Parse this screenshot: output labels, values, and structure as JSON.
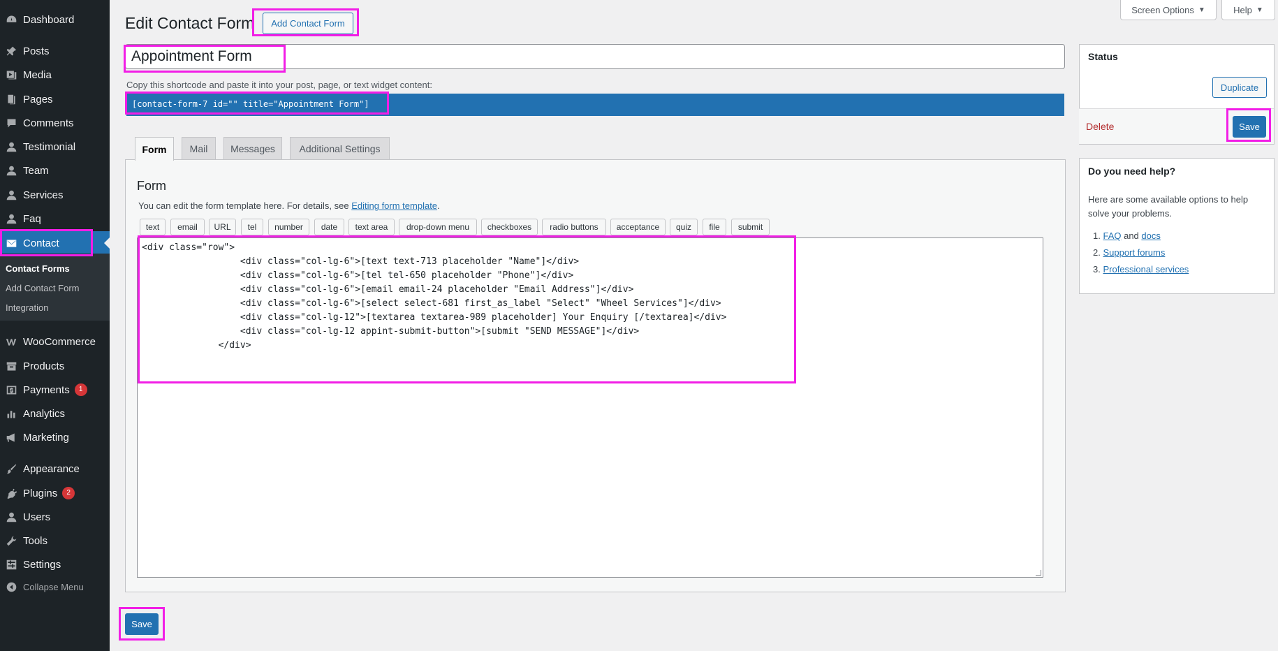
{
  "sidebar": {
    "items": [
      {
        "label": "Dashboard",
        "icon": "dashboard-icon"
      },
      {
        "label": "Posts",
        "icon": "pushpin-icon"
      },
      {
        "label": "Media",
        "icon": "media-icon"
      },
      {
        "label": "Pages",
        "icon": "pages-icon"
      },
      {
        "label": "Comments",
        "icon": "comments-icon"
      },
      {
        "label": "Testimonial",
        "icon": "user-icon"
      },
      {
        "label": "Team",
        "icon": "user-icon"
      },
      {
        "label": "Services",
        "icon": "user-icon"
      },
      {
        "label": "Faq",
        "icon": "user-icon"
      },
      {
        "label": "Contact",
        "icon": "envelope-icon"
      },
      {
        "label": "WooCommerce",
        "icon": "woocommerce-icon"
      },
      {
        "label": "Products",
        "icon": "archive-icon"
      },
      {
        "label": "Payments",
        "icon": "dollar-icon",
        "badge": "1"
      },
      {
        "label": "Analytics",
        "icon": "bar-chart-icon"
      },
      {
        "label": "Marketing",
        "icon": "megaphone-icon"
      },
      {
        "label": "Appearance",
        "icon": "paintbrush-icon"
      },
      {
        "label": "Plugins",
        "icon": "plugin-icon",
        "badge": "2"
      },
      {
        "label": "Users",
        "icon": "users-icon"
      },
      {
        "label": "Tools",
        "icon": "wrench-icon"
      },
      {
        "label": "Settings",
        "icon": "settings-icon"
      }
    ],
    "submenu": [
      "Contact Forms",
      "Add Contact Form",
      "Integration"
    ],
    "collapse_label": "Collapse Menu"
  },
  "header": {
    "title": "Edit Contact Form",
    "add_button": "Add Contact Form",
    "screen_options": "Screen Options",
    "help": "Help"
  },
  "form_title": "Appointment Form",
  "shortcode": {
    "description": "Copy this shortcode and paste it into your post, page, or text widget content:",
    "value": "[contact-form-7 id=\"\" title=\"Appointment Form\"]"
  },
  "tabs": [
    "Form",
    "Mail",
    "Messages",
    "Additional Settings"
  ],
  "panel": {
    "title": "Form",
    "desc_prefix": "You can edit the form template here. For details, see ",
    "desc_link": "Editing form template",
    "desc_suffix": "."
  },
  "tag_buttons": [
    "text",
    "email",
    "URL",
    "tel",
    "number",
    "date",
    "text area",
    "drop-down menu",
    "checkboxes",
    "radio buttons",
    "acceptance",
    "quiz",
    "file",
    "submit"
  ],
  "code_lines": [
    "<div class=\"row\">",
    "                  <div class=\"col-lg-6\">[text text-713 placeholder \"Name\"]</div>",
    "                  <div class=\"col-lg-6\">[tel tel-650 placeholder \"Phone\"]</div>",
    "                  <div class=\"col-lg-6\">[email email-24 placeholder \"Email Address\"]</div>",
    "                  <div class=\"col-lg-6\">[select select-681 first_as_label \"Select\" \"Wheel Services\"]</div>",
    "                  <div class=\"col-lg-12\">[textarea textarea-989 placeholder] Your Enquiry [/textarea]</div>",
    "                  <div class=\"col-lg-12 appint-submit-button\">[submit \"SEND MESSAGE\"]</div>",
    "              </div>"
  ],
  "status_box": {
    "title": "Status",
    "duplicate": "Duplicate",
    "delete": "Delete",
    "save": "Save"
  },
  "help_box": {
    "title": "Do you need help?",
    "text": "Here are some available options to help solve your problems.",
    "items": [
      {
        "num": "1.",
        "link1": "FAQ",
        "and": " and ",
        "link2": "docs"
      },
      {
        "num": "2.",
        "link1": "Support forums"
      },
      {
        "num": "3.",
        "link1": "Professional services"
      }
    ]
  },
  "bottom_save": "Save",
  "colors": {
    "accent": "#2271b1",
    "sidebar": "#1d2327",
    "highlight": "#f21ee6",
    "delete": "#b32d2e",
    "badge": "#d63638"
  }
}
